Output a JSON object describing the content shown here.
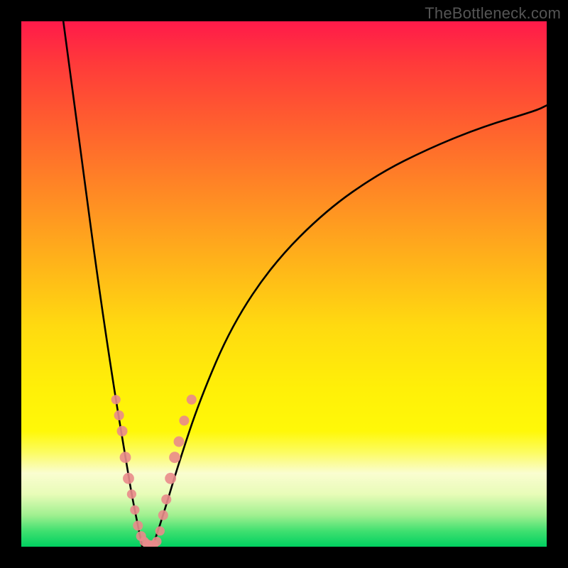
{
  "watermark": "TheBottleneck.com",
  "chart_data": {
    "type": "line",
    "title": "",
    "xlabel": "",
    "ylabel": "",
    "xlim": [
      0,
      100
    ],
    "ylim": [
      0,
      100
    ],
    "grid": false,
    "legend": false,
    "series": [
      {
        "name": "left-curve",
        "color": "#000000",
        "x": [
          8,
          10,
          12,
          14,
          16,
          18,
          19,
          20,
          21,
          22,
          23
        ],
        "y": [
          100,
          85,
          70,
          55,
          41,
          28,
          22,
          16,
          10,
          5,
          0
        ]
      },
      {
        "name": "right-curve",
        "color": "#000000",
        "x": [
          25,
          27,
          30,
          34,
          40,
          48,
          58,
          68,
          78,
          88,
          98,
          100
        ],
        "y": [
          0,
          6,
          16,
          28,
          42,
          54,
          64,
          71,
          76,
          80,
          83,
          84
        ]
      }
    ],
    "markers": [
      {
        "name": "left-markers",
        "color": "#e98b8b",
        "points": [
          {
            "x": 18.0,
            "y": 28,
            "r": 3.0
          },
          {
            "x": 18.6,
            "y": 25,
            "r": 3.2
          },
          {
            "x": 19.2,
            "y": 22,
            "r": 3.4
          },
          {
            "x": 19.8,
            "y": 17,
            "r": 3.6
          },
          {
            "x": 20.4,
            "y": 13,
            "r": 3.6
          },
          {
            "x": 21.0,
            "y": 10,
            "r": 3.0
          },
          {
            "x": 21.6,
            "y": 7,
            "r": 3.0
          },
          {
            "x": 22.2,
            "y": 4,
            "r": 3.2
          },
          {
            "x": 22.8,
            "y": 2,
            "r": 3.2
          },
          {
            "x": 23.4,
            "y": 1,
            "r": 3.0
          },
          {
            "x": 24.0,
            "y": 0.5,
            "r": 3.0
          },
          {
            "x": 24.6,
            "y": 0.3,
            "r": 3.0
          }
        ]
      },
      {
        "name": "right-markers",
        "color": "#e98b8b",
        "points": [
          {
            "x": 25.2,
            "y": 0.4,
            "r": 3.0
          },
          {
            "x": 25.8,
            "y": 1,
            "r": 3.0
          },
          {
            "x": 26.4,
            "y": 3,
            "r": 3.0
          },
          {
            "x": 27.0,
            "y": 6,
            "r": 3.2
          },
          {
            "x": 27.6,
            "y": 9,
            "r": 3.2
          },
          {
            "x": 28.4,
            "y": 13,
            "r": 3.6
          },
          {
            "x": 29.2,
            "y": 17,
            "r": 3.6
          },
          {
            "x": 30.0,
            "y": 20,
            "r": 3.4
          },
          {
            "x": 31.0,
            "y": 24,
            "r": 3.2
          },
          {
            "x": 32.4,
            "y": 28,
            "r": 3.2
          }
        ]
      }
    ],
    "background_gradient": {
      "stops": [
        {
          "pos": 0.0,
          "color": "#ff1a4a"
        },
        {
          "pos": 0.5,
          "color": "#ffda10"
        },
        {
          "pos": 0.8,
          "color": "#fff808"
        },
        {
          "pos": 1.0,
          "color": "#00d060"
        }
      ]
    }
  }
}
